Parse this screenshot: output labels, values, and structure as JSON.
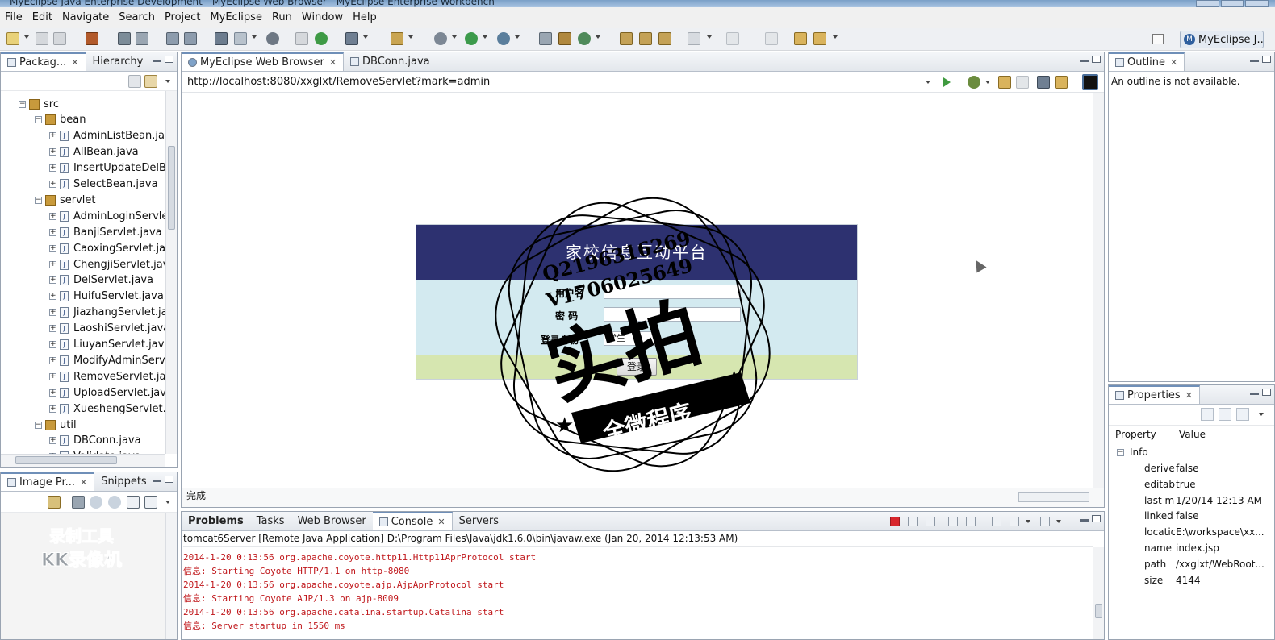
{
  "window": {
    "title": "MyEclipse Java Enterprise Development - MyEclipse Web Browser - MyEclipse Enterprise Workbench"
  },
  "menu": [
    "File",
    "Edit",
    "Navigate",
    "Search",
    "Project",
    "MyEclipse",
    "Run",
    "Window",
    "Help"
  ],
  "perspective": {
    "label": "MyEclipse J..."
  },
  "package_panel": {
    "tabs": [
      "Packag...",
      "Hierarchy"
    ],
    "tree": [
      {
        "label": "src",
        "level": 0,
        "kind": "folder"
      },
      {
        "label": "bean",
        "level": 1,
        "kind": "package"
      },
      {
        "label": "AdminListBean.jav",
        "level": 2,
        "kind": "file"
      },
      {
        "label": "AllBean.java",
        "level": 2,
        "kind": "file"
      },
      {
        "label": "InsertUpdateDelB",
        "level": 2,
        "kind": "file"
      },
      {
        "label": "SelectBean.java",
        "level": 2,
        "kind": "file"
      },
      {
        "label": "servlet",
        "level": 1,
        "kind": "package"
      },
      {
        "label": "AdminLoginServle",
        "level": 2,
        "kind": "file"
      },
      {
        "label": "BanjiServlet.java",
        "level": 2,
        "kind": "file"
      },
      {
        "label": "CaoxingServlet.jav",
        "level": 2,
        "kind": "file"
      },
      {
        "label": "ChengjiServlet.jav",
        "level": 2,
        "kind": "file"
      },
      {
        "label": "DelServlet.java",
        "level": 2,
        "kind": "file"
      },
      {
        "label": "HuifuServlet.java",
        "level": 2,
        "kind": "file"
      },
      {
        "label": "JiazhangServlet.ja",
        "level": 2,
        "kind": "file"
      },
      {
        "label": "LaoshiServlet.java",
        "level": 2,
        "kind": "file"
      },
      {
        "label": "LiuyanServlet.java",
        "level": 2,
        "kind": "file"
      },
      {
        "label": "ModifyAdminServ",
        "level": 2,
        "kind": "file"
      },
      {
        "label": "RemoveServlet.jav",
        "level": 2,
        "kind": "file"
      },
      {
        "label": "UploadServlet.jav",
        "level": 2,
        "kind": "file"
      },
      {
        "label": "XueshengServlet.j",
        "level": 2,
        "kind": "file"
      },
      {
        "label": "util",
        "level": 1,
        "kind": "package"
      },
      {
        "label": "DBConn.java",
        "level": 2,
        "kind": "file"
      },
      {
        "label": "Validate.java",
        "level": 2,
        "kind": "file"
      }
    ]
  },
  "image_panel": {
    "tabs": [
      "Image Pr...",
      "Snippets"
    ]
  },
  "editor": {
    "tabs": [
      "MyEclipse Web Browser",
      "DBConn.java"
    ],
    "url": "http://localhost:8080/xxglxt/RemoveServlet?mark=admin",
    "status": "完成"
  },
  "login_page": {
    "title": "家校信息互动平台",
    "username_label": "用户名",
    "password_label": "密 码",
    "role_label": "登录身份",
    "role_value": "学生",
    "login_button": "登录"
  },
  "watermark": {
    "qq": "Q2196316269",
    "vx": "V1706025649",
    "main": "实拍",
    "banner": "全微程序"
  },
  "overlay_logo": {
    "line1": "录制工具",
    "line2": "KK录像机"
  },
  "outline_panel": {
    "tab": "Outline",
    "message": "An outline is not available."
  },
  "properties_panel": {
    "tab": "Properties",
    "col_property": "Property",
    "col_value": "Value",
    "group": "Info",
    "rows": [
      {
        "key": "derive",
        "value": "false"
      },
      {
        "key": "editab",
        "value": "true"
      },
      {
        "key": "last m",
        "value": "1/20/14 12:13 AM"
      },
      {
        "key": "linked",
        "value": "false"
      },
      {
        "key": "locatic",
        "value": "E:\\workspace\\xx..."
      },
      {
        "key": "name",
        "value": "index.jsp"
      },
      {
        "key": "path",
        "value": "/xxglxt/WebRoot..."
      },
      {
        "key": "size",
        "value": "4144"
      }
    ]
  },
  "console_panel": {
    "tabs": [
      "Problems",
      "Tasks",
      "Web Browser",
      "Console",
      "Servers"
    ],
    "process": "tomcat6Server [Remote Java Application] D:\\Program Files\\Java\\jdk1.6.0\\bin\\javaw.exe (Jan 20, 2014 12:13:53 AM)",
    "lines": [
      "2014-1-20 0:13:56 org.apache.coyote.http11.Http11AprProtocol start",
      "信息: Starting Coyote HTTP/1.1 on http-8080",
      "2014-1-20 0:13:56 org.apache.coyote.ajp.AjpAprProtocol start",
      "信息: Starting Coyote AJP/1.3 on ajp-8009",
      "2014-1-20 0:13:56 org.apache.catalina.startup.Catalina start",
      "信息: Server startup in 1550 ms"
    ]
  },
  "colors": {
    "login_header": "#2d3170",
    "login_body": "#d3eaf0",
    "login_footer": "#d6e6b0",
    "console_text": "#c0181c"
  }
}
